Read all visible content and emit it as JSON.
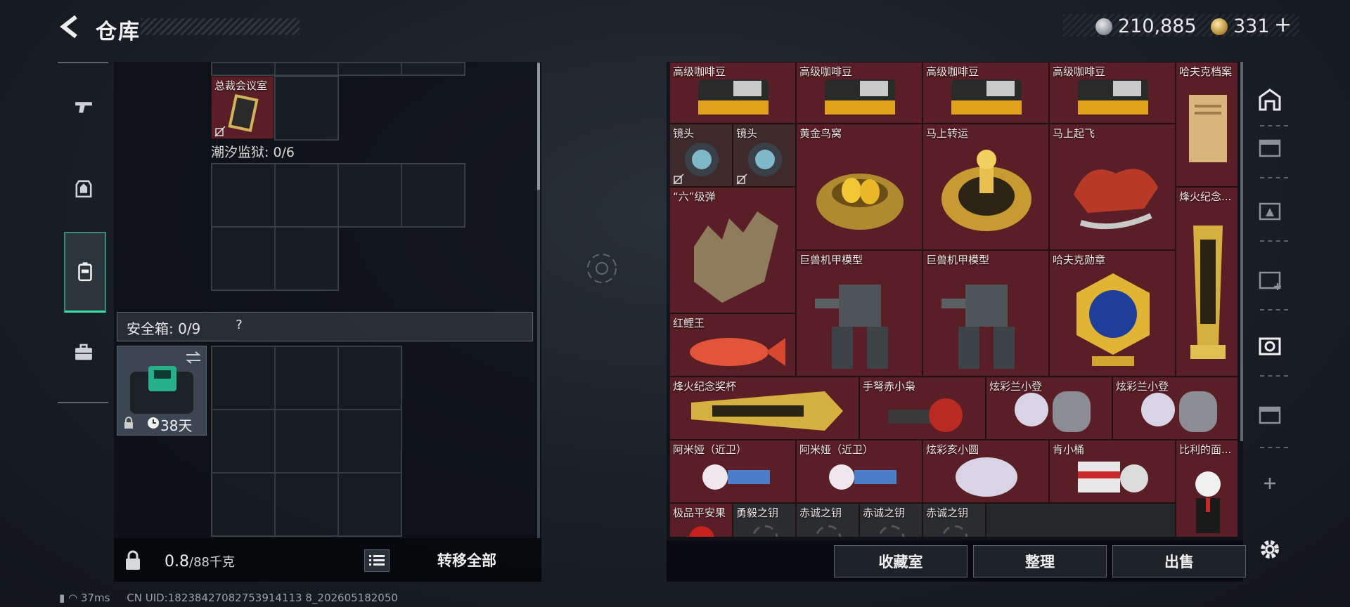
{
  "header": {
    "title": "仓库"
  },
  "currency": {
    "silver": "210,885",
    "gold": "331",
    "add": "+"
  },
  "left_rail": {
    "items": [
      "weapons",
      "armor",
      "backpack",
      "case"
    ]
  },
  "left_panel": {
    "top_item": "总裁会议室",
    "section1_label": "潮汐监狱: 0/6",
    "safe_box": {
      "title": "安全箱: 0/9",
      "help": "?",
      "days": "38天"
    },
    "weight": {
      "value": "0.8",
      "max": "/88千克"
    },
    "transfer_label": "转移全部"
  },
  "inventory": {
    "items": [
      {
        "name": "高级咖啡豆"
      },
      {
        "name": "高级咖啡豆"
      },
      {
        "name": "高级咖啡豆"
      },
      {
        "name": "高级咖啡豆"
      },
      {
        "name": "哈夫克档案"
      },
      {
        "name": "镜头"
      },
      {
        "name": "镜头"
      },
      {
        "name": "黄金鸟窝"
      },
      {
        "name": "马上转运"
      },
      {
        "name": "马上起飞"
      },
      {
        "name": "“六”级弹"
      },
      {
        "name": "烽火纪念..."
      },
      {
        "name": "巨兽机甲模型"
      },
      {
        "name": "巨兽机甲模型"
      },
      {
        "name": "哈夫克勋章"
      },
      {
        "name": "红鲤王"
      },
      {
        "name": "烽火纪念奖杯"
      },
      {
        "name": "手弩赤小枭"
      },
      {
        "name": "炫彩兰小登"
      },
      {
        "name": "炫彩兰小登"
      },
      {
        "name": "阿米娅（近卫）"
      },
      {
        "name": "阿米娅（近卫）"
      },
      {
        "name": "炫彩亥小圆"
      },
      {
        "name": "肯小桶"
      },
      {
        "name": "比利的面..."
      },
      {
        "name": "极品平安果"
      },
      {
        "name": "勇毅之钥"
      },
      {
        "name": "赤诚之钥"
      },
      {
        "name": "赤诚之钥"
      },
      {
        "name": "赤诚之钥"
      }
    ]
  },
  "actions": {
    "collection": "收藏室",
    "organize": "整理",
    "sell": "出售"
  },
  "status": {
    "ping": "37ms",
    "uid": "CN UID:18238427082753914113 8_202605182050"
  },
  "colors": {
    "accent_green": "#39e0a8",
    "item_bg": "#5a1f26"
  }
}
